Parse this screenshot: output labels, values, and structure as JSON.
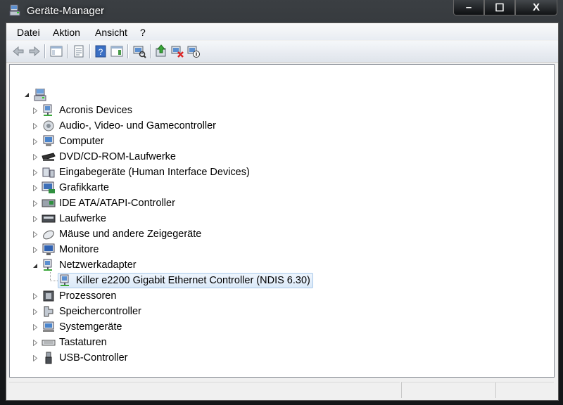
{
  "window": {
    "title": "Geräte-Manager",
    "caption": {
      "minimize": "–",
      "maximize": "☐",
      "close": "X"
    }
  },
  "menu": {
    "items": [
      "Datei",
      "Aktion",
      "Ansicht",
      "?"
    ]
  },
  "toolbar": {
    "buttons": [
      "back-icon",
      "forward-icon",
      "show-hide-console-tree-icon",
      "properties-icon",
      "help-icon",
      "show-action-pane-icon",
      "scan-hardware-icon",
      "update-driver-icon",
      "disable-device-icon",
      "uninstall-device-icon"
    ]
  },
  "tree": {
    "root": {
      "label": "",
      "expanded": true
    },
    "categories": [
      {
        "label": "Acronis Devices",
        "icon": "network-device-icon"
      },
      {
        "label": "Audio-, Video- und Gamecontroller",
        "icon": "speaker-icon"
      },
      {
        "label": "Computer",
        "icon": "computer-icon"
      },
      {
        "label": "DVD/CD-ROM-Laufwerke",
        "icon": "dvd-drive-icon"
      },
      {
        "label": "Eingabegeräte (Human Interface Devices)",
        "icon": "hid-icon"
      },
      {
        "label": "Grafikkarte",
        "icon": "display-adapter-icon"
      },
      {
        "label": "IDE ATA/ATAPI-Controller",
        "icon": "ide-controller-icon"
      },
      {
        "label": "Laufwerke",
        "icon": "disk-drive-icon"
      },
      {
        "label": "Mäuse und andere Zeigegeräte",
        "icon": "mouse-icon"
      },
      {
        "label": "Monitore",
        "icon": "monitor-icon"
      },
      {
        "label": "Netzwerkadapter",
        "icon": "network-adapter-icon",
        "expanded": true,
        "children": [
          {
            "label": "Killer e2200 Gigabit Ethernet Controller (NDIS 6.30)",
            "icon": "network-adapter-icon",
            "selected": true
          }
        ]
      },
      {
        "label": "Prozessoren",
        "icon": "processor-icon"
      },
      {
        "label": "Speichercontroller",
        "icon": "storage-controller-icon"
      },
      {
        "label": "Systemgeräte",
        "icon": "system-device-icon"
      },
      {
        "label": "Tastaturen",
        "icon": "keyboard-icon"
      },
      {
        "label": "USB-Controller",
        "icon": "usb-icon"
      }
    ]
  },
  "statusbar": {
    "panels": [
      "",
      "",
      ""
    ]
  }
}
